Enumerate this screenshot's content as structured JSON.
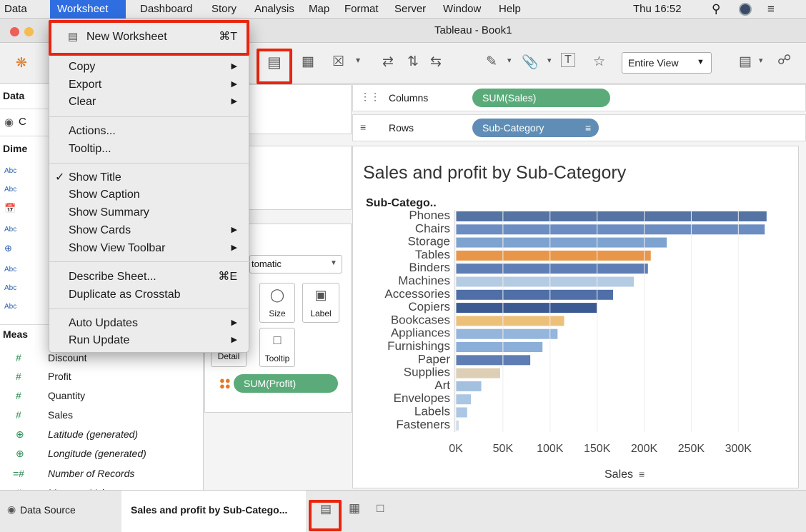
{
  "menubar": {
    "items": [
      "Data",
      "Worksheet",
      "Dashboard",
      "Story",
      "Analysis",
      "Map",
      "Format",
      "Server",
      "Window",
      "Help"
    ],
    "clock": "Thu 16:52"
  },
  "window": {
    "title": "Tableau - Book1"
  },
  "toolbar": {
    "fit_select": "Entire View"
  },
  "left_pane": {
    "data_header": "Data",
    "connection_initial": "C",
    "dimensions_header": "Dime",
    "measures_header": "Meas",
    "dim_icons": [
      "Abc",
      "Abc",
      "date-icon",
      "Abc",
      "globe-icon",
      "Abc",
      "Abc",
      "Abc"
    ],
    "measures": [
      {
        "icon": "#",
        "name": "Discount",
        "italic": false
      },
      {
        "icon": "#",
        "name": "Profit",
        "italic": false
      },
      {
        "icon": "#",
        "name": "Quantity",
        "italic": false
      },
      {
        "icon": "#",
        "name": "Sales",
        "italic": false
      },
      {
        "icon": "⊕",
        "name": "Latitude (generated)",
        "italic": true
      },
      {
        "icon": "⊕",
        "name": "Longitude (generated)",
        "italic": true
      },
      {
        "icon": "=#",
        "name": "Number of Records",
        "italic": true
      },
      {
        "icon": "#",
        "name": "Measure Values",
        "italic": true
      }
    ]
  },
  "marks": {
    "type_select": "tomatic",
    "buttons": {
      "size": "Size",
      "label": "Label",
      "detail": "Detail",
      "tooltip": "Tooltip"
    },
    "color_pill": "SUM(Profit)"
  },
  "shelves": {
    "columns_label": "Columns",
    "columns_pill": "SUM(Sales)",
    "rows_label": "Rows",
    "rows_pill": "Sub-Category"
  },
  "tabs": {
    "data_source": "Data Source",
    "sheet": "Sales and profit by Sub-Catego..."
  },
  "worksheet_menu": {
    "new_worksheet": {
      "label": "New Worksheet",
      "shortcut": "⌘T"
    },
    "items": [
      {
        "label": "Copy",
        "submenu": true
      },
      {
        "label": "Export",
        "submenu": true
      },
      {
        "label": "Clear",
        "submenu": true
      },
      {
        "label": "Actions...",
        "submenu": false
      },
      {
        "label": "Tooltip...",
        "submenu": false
      },
      {
        "label": "Show Title",
        "checked": true
      },
      {
        "label": "Show Caption"
      },
      {
        "label": "Show Summary"
      },
      {
        "label": "Show Cards",
        "submenu": true
      },
      {
        "label": "Show View Toolbar",
        "submenu": true
      },
      {
        "label": "Describe Sheet...",
        "shortcut": "⌘E"
      },
      {
        "label": "Duplicate as Crosstab"
      },
      {
        "label": "Auto Updates",
        "submenu": true
      },
      {
        "label": "Run Update",
        "submenu": true
      }
    ]
  },
  "chart_data": {
    "type": "bar",
    "title": "Sales and profit by Sub-Category",
    "row_header": "Sub-Catego..",
    "xlabel": "Sales",
    "xlim": [
      0,
      340000
    ],
    "ticks": [
      0,
      50000,
      100000,
      150000,
      200000,
      250000,
      300000
    ],
    "tick_labels": [
      "0K",
      "50K",
      "100K",
      "150K",
      "200K",
      "250K",
      "300K"
    ],
    "categories": [
      "Phones",
      "Chairs",
      "Storage",
      "Tables",
      "Binders",
      "Machines",
      "Accessories",
      "Copiers",
      "Bookcases",
      "Appliances",
      "Furnishings",
      "Paper",
      "Supplies",
      "Art",
      "Envelopes",
      "Labels",
      "Fasteners"
    ],
    "values": [
      330000,
      328000,
      224000,
      207000,
      204000,
      189000,
      167000,
      150000,
      115000,
      108000,
      92000,
      79000,
      47000,
      27000,
      16000,
      12000,
      3000
    ],
    "colors": [
      "#5573a3",
      "#6b8dc1",
      "#7ea3d1",
      "#e8974a",
      "#5e7eb5",
      "#b5cbe3",
      "#4f6fa6",
      "#3c5a92",
      "#edc07a",
      "#94b5dc",
      "#8cafd9",
      "#5d7db4",
      "#dccfb5",
      "#a3c0df",
      "#a9c6e3",
      "#abc7e4",
      "#cfdced"
    ],
    "color_encoding": "SUM(Profit)"
  }
}
